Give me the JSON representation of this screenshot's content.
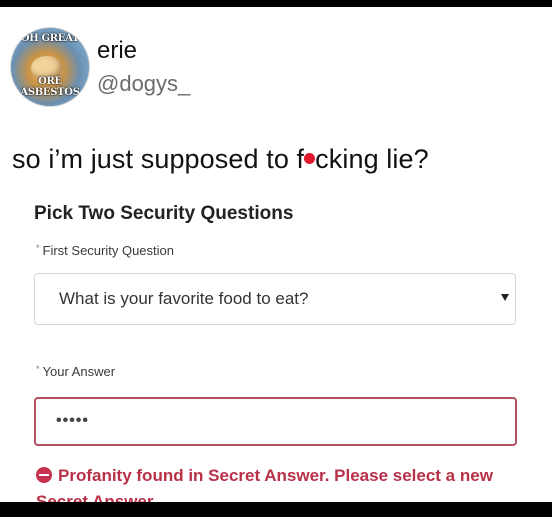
{
  "tweet": {
    "avatar_top_text": "OH GREAT",
    "avatar_bottom_text": "ORE ASBESTOS",
    "display_name": "erie",
    "handle": "@dogys_",
    "text_before": "so i’m just supposed to f",
    "text_after": "cking lie?"
  },
  "form": {
    "title": "Pick Two Security Questions",
    "required_mark": "*",
    "question_label": "First Security Question",
    "question_value": "What is your favorite food to eat?",
    "answer_label": "Your Answer",
    "answer_value": "•••••",
    "error_message": "Profanity found in Secret Answer. Please select a new Secret Answer."
  },
  "colors": {
    "error": "#b83148",
    "redaction_dot": "#e2192c",
    "answer_border": "#b5505e"
  }
}
